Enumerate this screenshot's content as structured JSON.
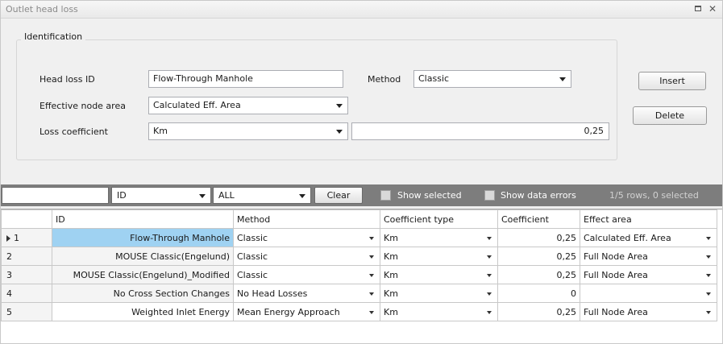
{
  "window": {
    "title": "Outlet head loss"
  },
  "identification": {
    "legend": "Identification",
    "head_loss_id_label": "Head loss ID",
    "head_loss_id_value": "Flow-Through Manhole",
    "method_label": "Method",
    "method_value": "Classic",
    "effective_node_area_label": "Effective node area",
    "effective_node_area_value": "Calculated Eff. Area",
    "loss_coefficient_label": "Loss coefficient",
    "loss_coefficient_value": "Km",
    "coefficient_value": "0,25"
  },
  "buttons": {
    "insert": "Insert",
    "delete": "Delete"
  },
  "filter_bar": {
    "field": "ID",
    "scope": "ALL",
    "clear": "Clear",
    "show_selected": "Show selected",
    "show_data_errors": "Show data errors",
    "status": "1/5 rows, 0 selected"
  },
  "grid": {
    "columns": [
      "ID",
      "Method",
      "Coefficient type",
      "Coefficient",
      "Effect area"
    ],
    "rows": [
      {
        "num": "1",
        "id": "Flow-Through Manhole",
        "method": "Classic",
        "ctype": "Km",
        "coef": "0,25",
        "area": "Calculated Eff. Area"
      },
      {
        "num": "2",
        "id": "MOUSE Classic(Engelund)",
        "method": "Classic",
        "ctype": "Km",
        "coef": "0,25",
        "area": "Full Node Area"
      },
      {
        "num": "3",
        "id": "MOUSE Classic(Engelund)_Modified",
        "method": "Classic",
        "ctype": "Km",
        "coef": "0,25",
        "area": "Full Node Area"
      },
      {
        "num": "4",
        "id": "No Cross Section Changes",
        "method": "No Head Losses",
        "ctype": "Km",
        "coef": "0",
        "area": ""
      },
      {
        "num": "5",
        "id": "Weighted Inlet Energy",
        "method": "Mean Energy Approach",
        "ctype": "Km",
        "coef": "0,25",
        "area": "Full Node Area"
      }
    ]
  },
  "colors": {
    "filter_bar_bg": "#7d7d7d",
    "selected_cell": "#9fd2f2"
  },
  "icons": {
    "maximize": "maximize-icon",
    "close": "close-icon"
  }
}
